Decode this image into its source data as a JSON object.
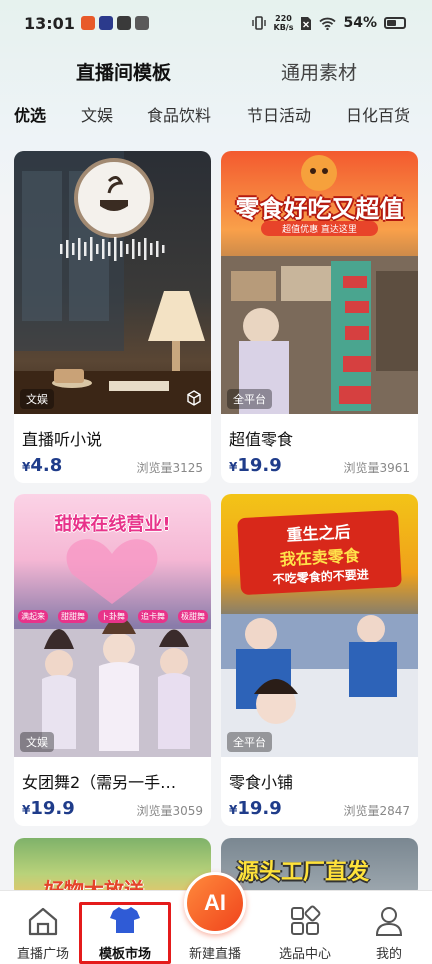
{
  "status_bar": {
    "time": "13:01",
    "net_speed_value": "220",
    "net_speed_unit": "KB/s",
    "battery": "54%"
  },
  "top_tabs": [
    {
      "label": "直播间模板",
      "active": true
    },
    {
      "label": "通用素材",
      "active": false
    }
  ],
  "categories": [
    {
      "label": "优选",
      "active": true
    },
    {
      "label": "文娱",
      "active": false
    },
    {
      "label": "食品饮料",
      "active": false
    },
    {
      "label": "节日活动",
      "active": false
    },
    {
      "label": "日化百货",
      "active": false
    }
  ],
  "cards": [
    {
      "tag": "文娱",
      "title": "直播听小说",
      "price_symbol": "¥",
      "price": "4.8",
      "views": "浏览量3125"
    },
    {
      "tag": "全平台",
      "title": "超值零食",
      "price_symbol": "¥",
      "price": "19.9",
      "views": "浏览量3961",
      "banner": "零食好吃又超值",
      "banner_sub": "超值优惠 直达这里"
    },
    {
      "tag": "文娱",
      "title": "女团舞2（需另一手…",
      "price_symbol": "¥",
      "price": "19.9",
      "views": "浏览量3059",
      "banner": "甜妹在线营业!",
      "chips": [
        "满起来",
        "甜甜舞",
        "卜卦舞",
        "追卡舞",
        "极甜舞"
      ]
    },
    {
      "tag": "全平台",
      "title": "零食小铺",
      "price_symbol": "¥",
      "price": "19.9",
      "views": "浏览量2847",
      "banner_lines": [
        "重生之后",
        "我在卖零食",
        "不吃零食的不要进"
      ]
    },
    {
      "banner": "好物大放送"
    },
    {
      "banner": "源头工厂直发"
    }
  ],
  "bottom_nav": [
    {
      "label": "直播广场",
      "icon": "home-icon",
      "active": false
    },
    {
      "label": "模板市场",
      "icon": "tshirt-icon",
      "active": true
    },
    {
      "label": "新建直播",
      "icon": "ai-icon",
      "active": false,
      "badge": "AI"
    },
    {
      "label": "选品中心",
      "icon": "grid-icon",
      "active": false
    },
    {
      "label": "我的",
      "icon": "person-icon",
      "active": false
    }
  ],
  "colors": {
    "price": "#1f3c8a",
    "accent_active_nav": "#2f5bd6",
    "ai_button": "#f0431c",
    "highlight": "#e41b1b"
  }
}
